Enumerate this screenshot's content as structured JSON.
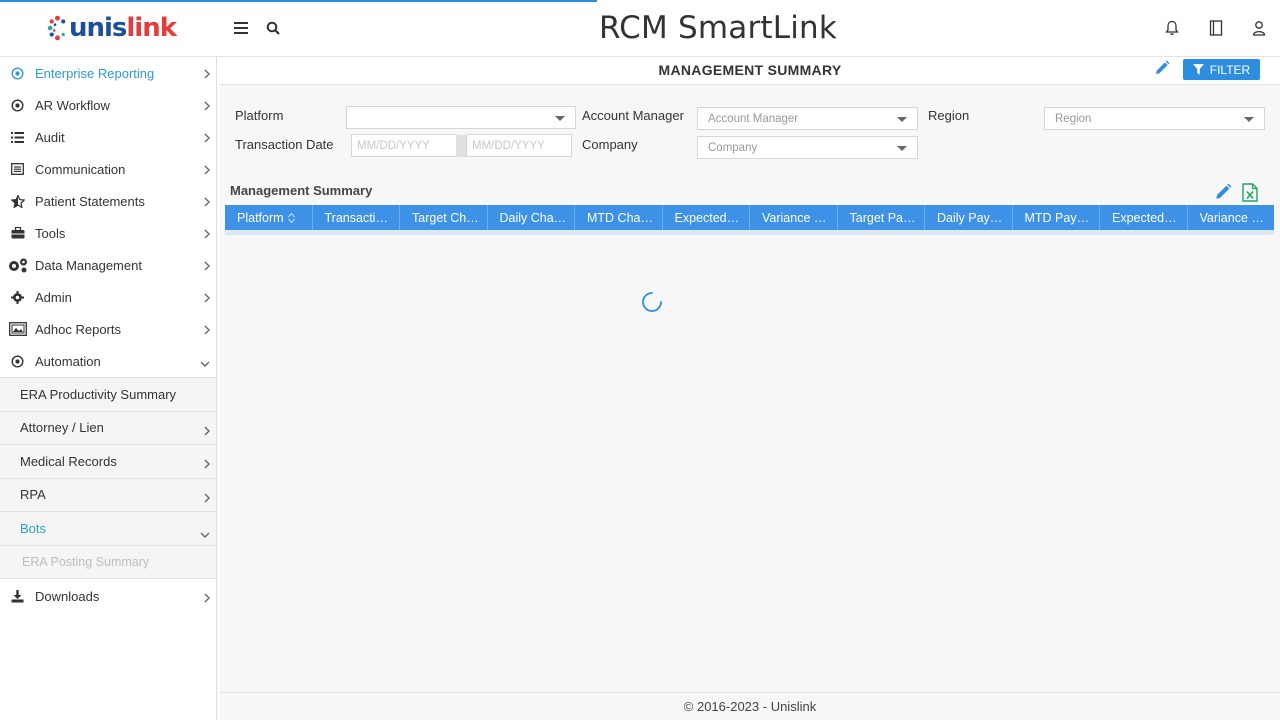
{
  "app": {
    "title": "RCM SmartLink",
    "logo_text_a": "unis",
    "logo_text_b": "link",
    "brand_colors": {
      "primary": "#1b4f9c",
      "accent": "#e23d3d",
      "highlight": "#2d9bd6",
      "button": "#2d8ee0"
    }
  },
  "header": {
    "icons": [
      "hamburger-icon",
      "search-icon",
      "bell-icon",
      "book-icon",
      "user-icon"
    ]
  },
  "sidebar": {
    "items": [
      {
        "label": "Enterprise Reporting",
        "icon": "target-icon",
        "active": true
      },
      {
        "label": "AR Workflow",
        "icon": "target-icon"
      },
      {
        "label": "Audit",
        "icon": "list-icon"
      },
      {
        "label": "Communication",
        "icon": "list-alt-icon"
      },
      {
        "label": "Patient Statements",
        "icon": "star-half-icon"
      },
      {
        "label": "Tools",
        "icon": "toolbox-icon"
      },
      {
        "label": "Data Management",
        "icon": "gears-icon"
      },
      {
        "label": "Admin",
        "icon": "gear-icon"
      },
      {
        "label": "Adhoc Reports",
        "icon": "image-report-icon"
      },
      {
        "label": "Automation",
        "icon": "target-icon",
        "expanded": true
      }
    ],
    "sub_items": [
      {
        "label": "ERA Productivity Summary"
      },
      {
        "label": "Attorney / Lien"
      },
      {
        "label": "Medical Records"
      },
      {
        "label": "RPA"
      },
      {
        "label": "Bots",
        "active": true,
        "expanded": true
      }
    ],
    "sub_sub_items": [
      {
        "label": "ERA Posting Summary"
      }
    ],
    "downloads": {
      "label": "Downloads",
      "icon": "download-icon"
    }
  },
  "page": {
    "title": "MANAGEMENT SUMMARY",
    "filter_button": "FILTER"
  },
  "filters": {
    "platform_label": "Platform",
    "platform_value": "",
    "account_manager_label": "Account Manager",
    "account_manager_placeholder": "Account Manager",
    "region_label": "Region",
    "region_placeholder": "Region",
    "transaction_date_label": "Transaction Date",
    "date_from_placeholder": "MM/DD/YYYY",
    "date_to_placeholder": "MM/DD/YYYY",
    "company_label": "Company",
    "company_placeholder": "Company"
  },
  "grid": {
    "title": "Management Summary",
    "columns": [
      "Platform",
      "Transacti…",
      "Target Ch…",
      "Daily Cha…",
      "MTD Cha…",
      "Expected…",
      "Variance …",
      "Target Pa…",
      "Daily Pay…",
      "MTD Pay…",
      "Expected…",
      "Variance …"
    ],
    "rows": [],
    "loading": true
  },
  "footer": {
    "text": "© 2016-2023 - Unislink"
  }
}
